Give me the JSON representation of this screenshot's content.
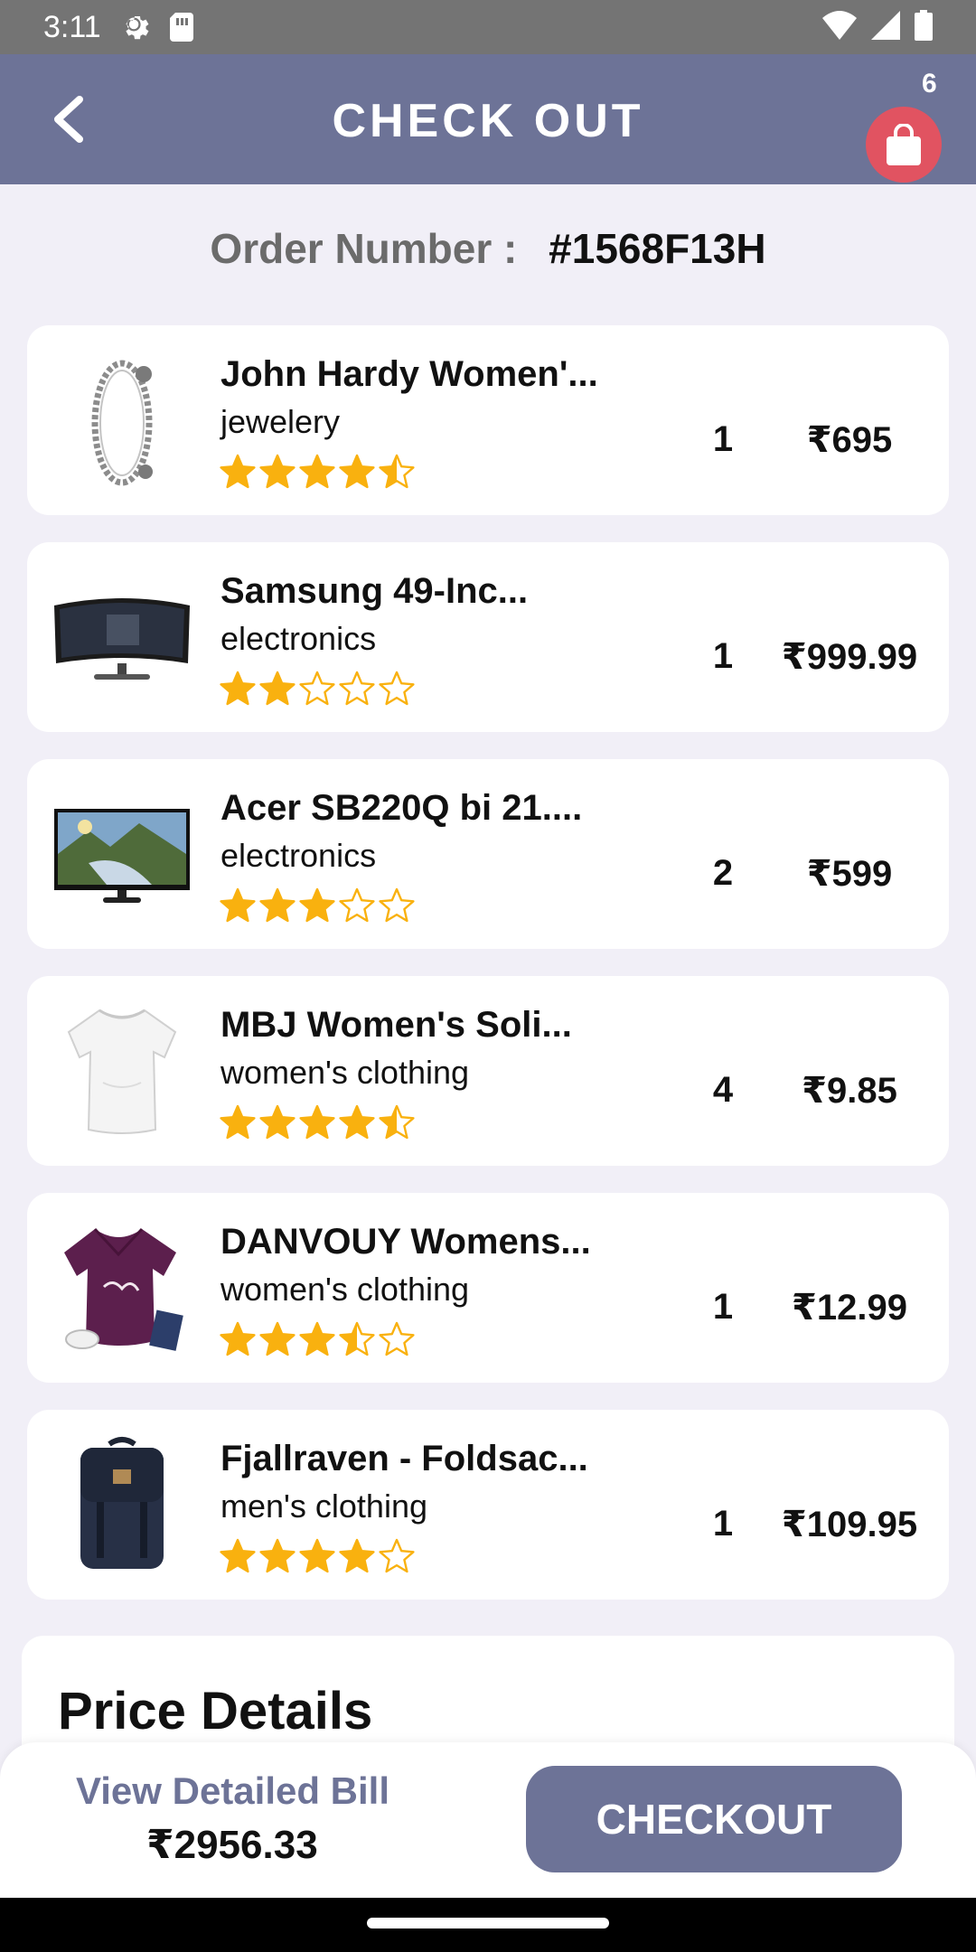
{
  "status_bar": {
    "time": "3:11",
    "icons": [
      "settings-gear-icon",
      "sim-card-icon",
      "wifi-icon",
      "cell-signal-icon",
      "battery-icon"
    ]
  },
  "app_bar": {
    "title": "CHECK OUT",
    "back_icon": "chevron-left-icon",
    "cart_icon": "shopping-bag-icon",
    "cart_count": "6",
    "colors": {
      "bar": "#6d7397",
      "cart": "#e15361"
    }
  },
  "order": {
    "label": "Order Number :",
    "number": "#1568F13H"
  },
  "products": [
    {
      "name": "John Hardy Women'...",
      "category": "jewelery",
      "qty": "1",
      "price": "₹695",
      "rating": 4.5,
      "thumb": "bracelet"
    },
    {
      "name": "Samsung 49-Inc...",
      "category": "electronics",
      "qty": "1",
      "price": "₹999.99",
      "rating": 2,
      "thumb": "curved-monitor"
    },
    {
      "name": "Acer SB220Q bi 21....",
      "category": "electronics",
      "qty": "2",
      "price": "₹599",
      "rating": 3,
      "thumb": "monitor"
    },
    {
      "name": "MBJ Women's Soli...",
      "category": "women's clothing",
      "qty": "4",
      "price": "₹9.85",
      "rating": 4.5,
      "thumb": "white-tshirt"
    },
    {
      "name": "DANVOUY Womens...",
      "category": "women's clothing",
      "qty": "1",
      "price": "₹12.99",
      "rating": 3.5,
      "thumb": "purple-tshirt"
    },
    {
      "name": "Fjallraven - Foldsac...",
      "category": "men's clothing",
      "qty": "1",
      "price": "₹109.95",
      "rating": 4,
      "thumb": "backpack"
    }
  ],
  "price_details": {
    "title": "Price Details"
  },
  "bottom_bar": {
    "view_bill_label": "View Detailed Bill",
    "total": "₹2956.33",
    "checkout_label": "CHECKOUT"
  },
  "theme": {
    "star": "#f9b10f",
    "accent": "#6d7397"
  }
}
